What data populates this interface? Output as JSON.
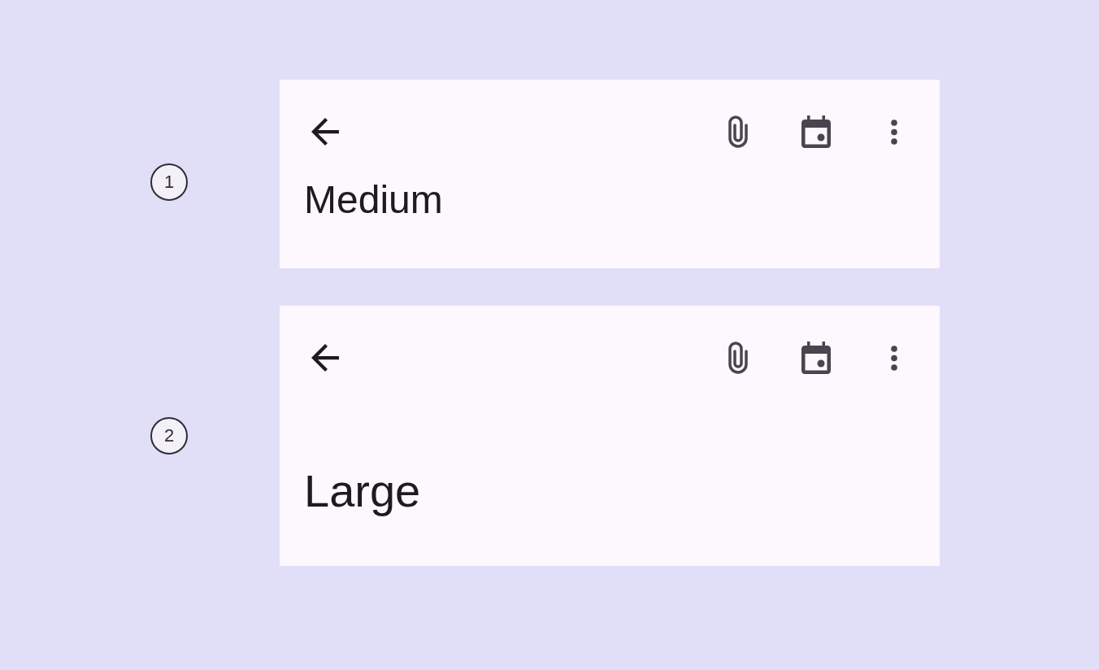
{
  "variants": [
    {
      "kind": "medium",
      "callout": "1",
      "title": "Medium"
    },
    {
      "kind": "large",
      "callout": "2",
      "title": "Large"
    }
  ]
}
